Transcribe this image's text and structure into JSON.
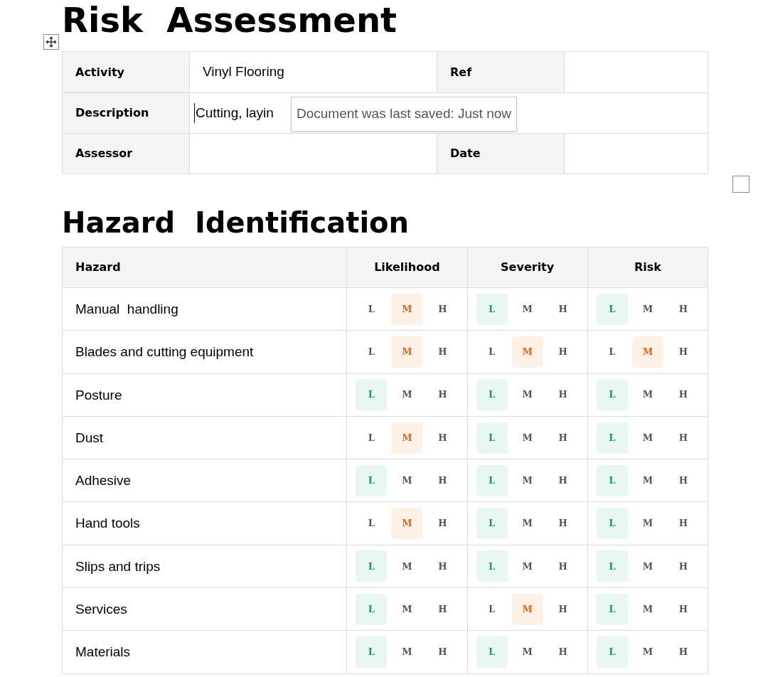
{
  "title": "Risk  Assessment",
  "details": {
    "rows": [
      {
        "label": "Activity",
        "value": "Vinyl Flooring",
        "label_2": "Ref",
        "value_2": ""
      },
      {
        "label": "Description",
        "value": "Cutting, layin",
        "tooltip": "Document was last saved: Just now"
      },
      {
        "label": "Assessor",
        "value": "",
        "label_2": "Date",
        "value_2": ""
      }
    ]
  },
  "section_title": "Hazard  Identification",
  "hazards": {
    "columns": [
      "Hazard",
      "Likelihood",
      "Severity",
      "Risk"
    ],
    "rows": [
      {
        "name": "Manual  handling",
        "ratings": [
          [
            {
              "label": "L",
              "selected": false
            },
            {
              "label": "M",
              "selected": true
            },
            {
              "label": "H",
              "selected": false
            }
          ],
          [
            {
              "label": "L",
              "selected": true
            },
            {
              "label": "M",
              "selected": false
            },
            {
              "label": "H",
              "selected": false
            }
          ],
          [
            {
              "label": "L",
              "selected": true
            },
            {
              "label": "M",
              "selected": false
            },
            {
              "label": "H",
              "selected": false
            }
          ]
        ]
      },
      {
        "name": "Blades and cutting equipment",
        "ratings": [
          [
            {
              "label": "L",
              "selected": false
            },
            {
              "label": "M",
              "selected": true
            },
            {
              "label": "H",
              "selected": false
            }
          ],
          [
            {
              "label": "L",
              "selected": false
            },
            {
              "label": "M",
              "selected": true
            },
            {
              "label": "H",
              "selected": false
            }
          ],
          [
            {
              "label": "L",
              "selected": false
            },
            {
              "label": "M",
              "selected": true
            },
            {
              "label": "H",
              "selected": false
            }
          ]
        ]
      },
      {
        "name": "Posture",
        "ratings": [
          [
            {
              "label": "L",
              "selected": true
            },
            {
              "label": "M",
              "selected": false
            },
            {
              "label": "H",
              "selected": false
            }
          ],
          [
            {
              "label": "L",
              "selected": true
            },
            {
              "label": "M",
              "selected": false
            },
            {
              "label": "H",
              "selected": false
            }
          ],
          [
            {
              "label": "L",
              "selected": true
            },
            {
              "label": "M",
              "selected": false
            },
            {
              "label": "H",
              "selected": false
            }
          ]
        ]
      },
      {
        "name": "Dust",
        "ratings": [
          [
            {
              "label": "L",
              "selected": false
            },
            {
              "label": "M",
              "selected": true
            },
            {
              "label": "H",
              "selected": false
            }
          ],
          [
            {
              "label": "L",
              "selected": true
            },
            {
              "label": "M",
              "selected": false
            },
            {
              "label": "H",
              "selected": false
            }
          ],
          [
            {
              "label": "L",
              "selected": true
            },
            {
              "label": "M",
              "selected": false
            },
            {
              "label": "H",
              "selected": false
            }
          ]
        ]
      },
      {
        "name": "Adhesive",
        "ratings": [
          [
            {
              "label": "L",
              "selected": true
            },
            {
              "label": "M",
              "selected": false
            },
            {
              "label": "H",
              "selected": false
            }
          ],
          [
            {
              "label": "L",
              "selected": true
            },
            {
              "label": "M",
              "selected": false
            },
            {
              "label": "H",
              "selected": false
            }
          ],
          [
            {
              "label": "L",
              "selected": true
            },
            {
              "label": "M",
              "selected": false
            },
            {
              "label": "H",
              "selected": false
            }
          ]
        ]
      },
      {
        "name": "Hand tools",
        "ratings": [
          [
            {
              "label": "L",
              "selected": false
            },
            {
              "label": "M",
              "selected": true
            },
            {
              "label": "H",
              "selected": false
            }
          ],
          [
            {
              "label": "L",
              "selected": true
            },
            {
              "label": "M",
              "selected": false
            },
            {
              "label": "H",
              "selected": false
            }
          ],
          [
            {
              "label": "L",
              "selected": true
            },
            {
              "label": "M",
              "selected": false
            },
            {
              "label": "H",
              "selected": false
            }
          ]
        ]
      },
      {
        "name": "Slips and trips",
        "ratings": [
          [
            {
              "label": "L",
              "selected": true
            },
            {
              "label": "M",
              "selected": false
            },
            {
              "label": "H",
              "selected": false
            }
          ],
          [
            {
              "label": "L",
              "selected": true
            },
            {
              "label": "M",
              "selected": false
            },
            {
              "label": "H",
              "selected": false
            }
          ],
          [
            {
              "label": "L",
              "selected": true
            },
            {
              "label": "M",
              "selected": false
            },
            {
              "label": "H",
              "selected": false
            }
          ]
        ]
      },
      {
        "name": "Services",
        "ratings": [
          [
            {
              "label": "L",
              "selected": true
            },
            {
              "label": "M",
              "selected": false
            },
            {
              "label": "H",
              "selected": false
            }
          ],
          [
            {
              "label": "L",
              "selected": false
            },
            {
              "label": "M",
              "selected": true
            },
            {
              "label": "H",
              "selected": false
            }
          ],
          [
            {
              "label": "L",
              "selected": true
            },
            {
              "label": "M",
              "selected": false
            },
            {
              "label": "H",
              "selected": false
            }
          ]
        ]
      },
      {
        "name": "Materials",
        "ratings": [
          [
            {
              "label": "L",
              "selected": true
            },
            {
              "label": "M",
              "selected": false
            },
            {
              "label": "H",
              "selected": false
            }
          ],
          [
            {
              "label": "L",
              "selected": true
            },
            {
              "label": "M",
              "selected": false
            },
            {
              "label": "H",
              "selected": false
            }
          ],
          [
            {
              "label": "L",
              "selected": true
            },
            {
              "label": "M",
              "selected": false
            },
            {
              "label": "H",
              "selected": false
            }
          ]
        ]
      }
    ]
  }
}
